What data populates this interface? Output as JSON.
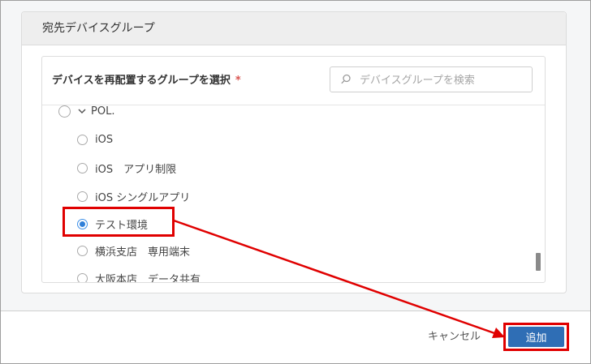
{
  "dialog": {
    "section_title": "宛先デバイスグループ",
    "select_label": "デバイスを再配置するグループを選択",
    "required_mark": "*",
    "search": {
      "placeholder": "デバイスグループを検索",
      "value": ""
    },
    "tree": {
      "parent": {
        "label": "POL.",
        "expanded": true,
        "selected": false
      },
      "children": [
        {
          "label": "iOS",
          "selected": false
        },
        {
          "label": "iOS　アプリ制限",
          "selected": false
        },
        {
          "label": "iOS シングルアプリ",
          "selected": false
        },
        {
          "label": "テスト環境",
          "selected": true
        },
        {
          "label": "横浜支店　専用端末",
          "selected": false
        },
        {
          "label": "大阪本店　データ共有",
          "selected": false
        }
      ]
    }
  },
  "footer": {
    "cancel_label": "キャンセル",
    "add_label": "追加"
  },
  "colors": {
    "accent": "#2f6eb5",
    "highlight": "#e00000",
    "radio_checked": "#2f7fd8"
  }
}
